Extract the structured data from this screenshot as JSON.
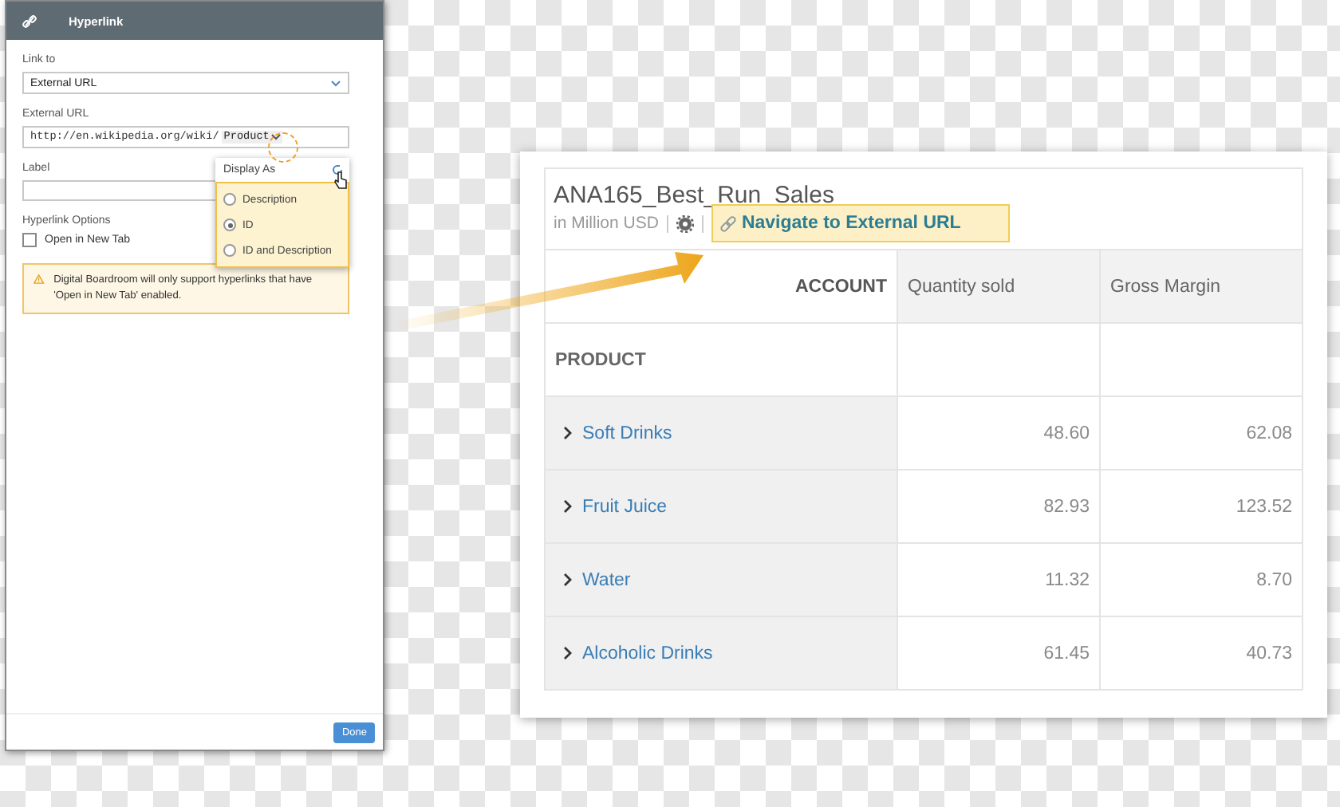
{
  "dialog": {
    "title": "Hyperlink",
    "link_to": {
      "label": "Link to",
      "value": "External URL"
    },
    "external_url": {
      "label": "External URL",
      "value": "http://en.wikipedia.org/wiki/",
      "token": "Product"
    },
    "display_menu": {
      "title": "Display As",
      "options": [
        {
          "label": "Description",
          "selected": false
        },
        {
          "label": "ID",
          "selected": true
        },
        {
          "label": "ID and Description",
          "selected": false
        }
      ]
    },
    "label_field": {
      "label": "Label"
    },
    "options": {
      "heading": "Hyperlink Options",
      "open_in_new_tab": {
        "label": "Open in New Tab",
        "checked": false
      }
    },
    "warning": "Digital Boardroom will only support hyperlinks that have 'Open in New Tab' enabled.",
    "done_button": "Done"
  },
  "report": {
    "title": "ANA165_Best_Run_Sales",
    "subtitle": "in Million USD",
    "link_tooltip": "Navigate to External URL",
    "table": {
      "corner_label": "ACCOUNT",
      "columns": [
        "Quantity sold",
        "Gross Margin"
      ],
      "row_header": "PRODUCT",
      "rows": [
        {
          "name": "Soft Drinks",
          "expanded": false,
          "values": [
            "48.60",
            "62.08"
          ]
        },
        {
          "name": "Fruit Juice",
          "expanded": false,
          "values": [
            "82.93",
            "123.52"
          ]
        },
        {
          "name": "Water",
          "expanded": false,
          "values": [
            "11.32",
            "8.70"
          ]
        },
        {
          "name": "Alcoholic Drinks",
          "expanded": false,
          "values": [
            "61.45",
            "40.73"
          ]
        }
      ]
    }
  }
}
